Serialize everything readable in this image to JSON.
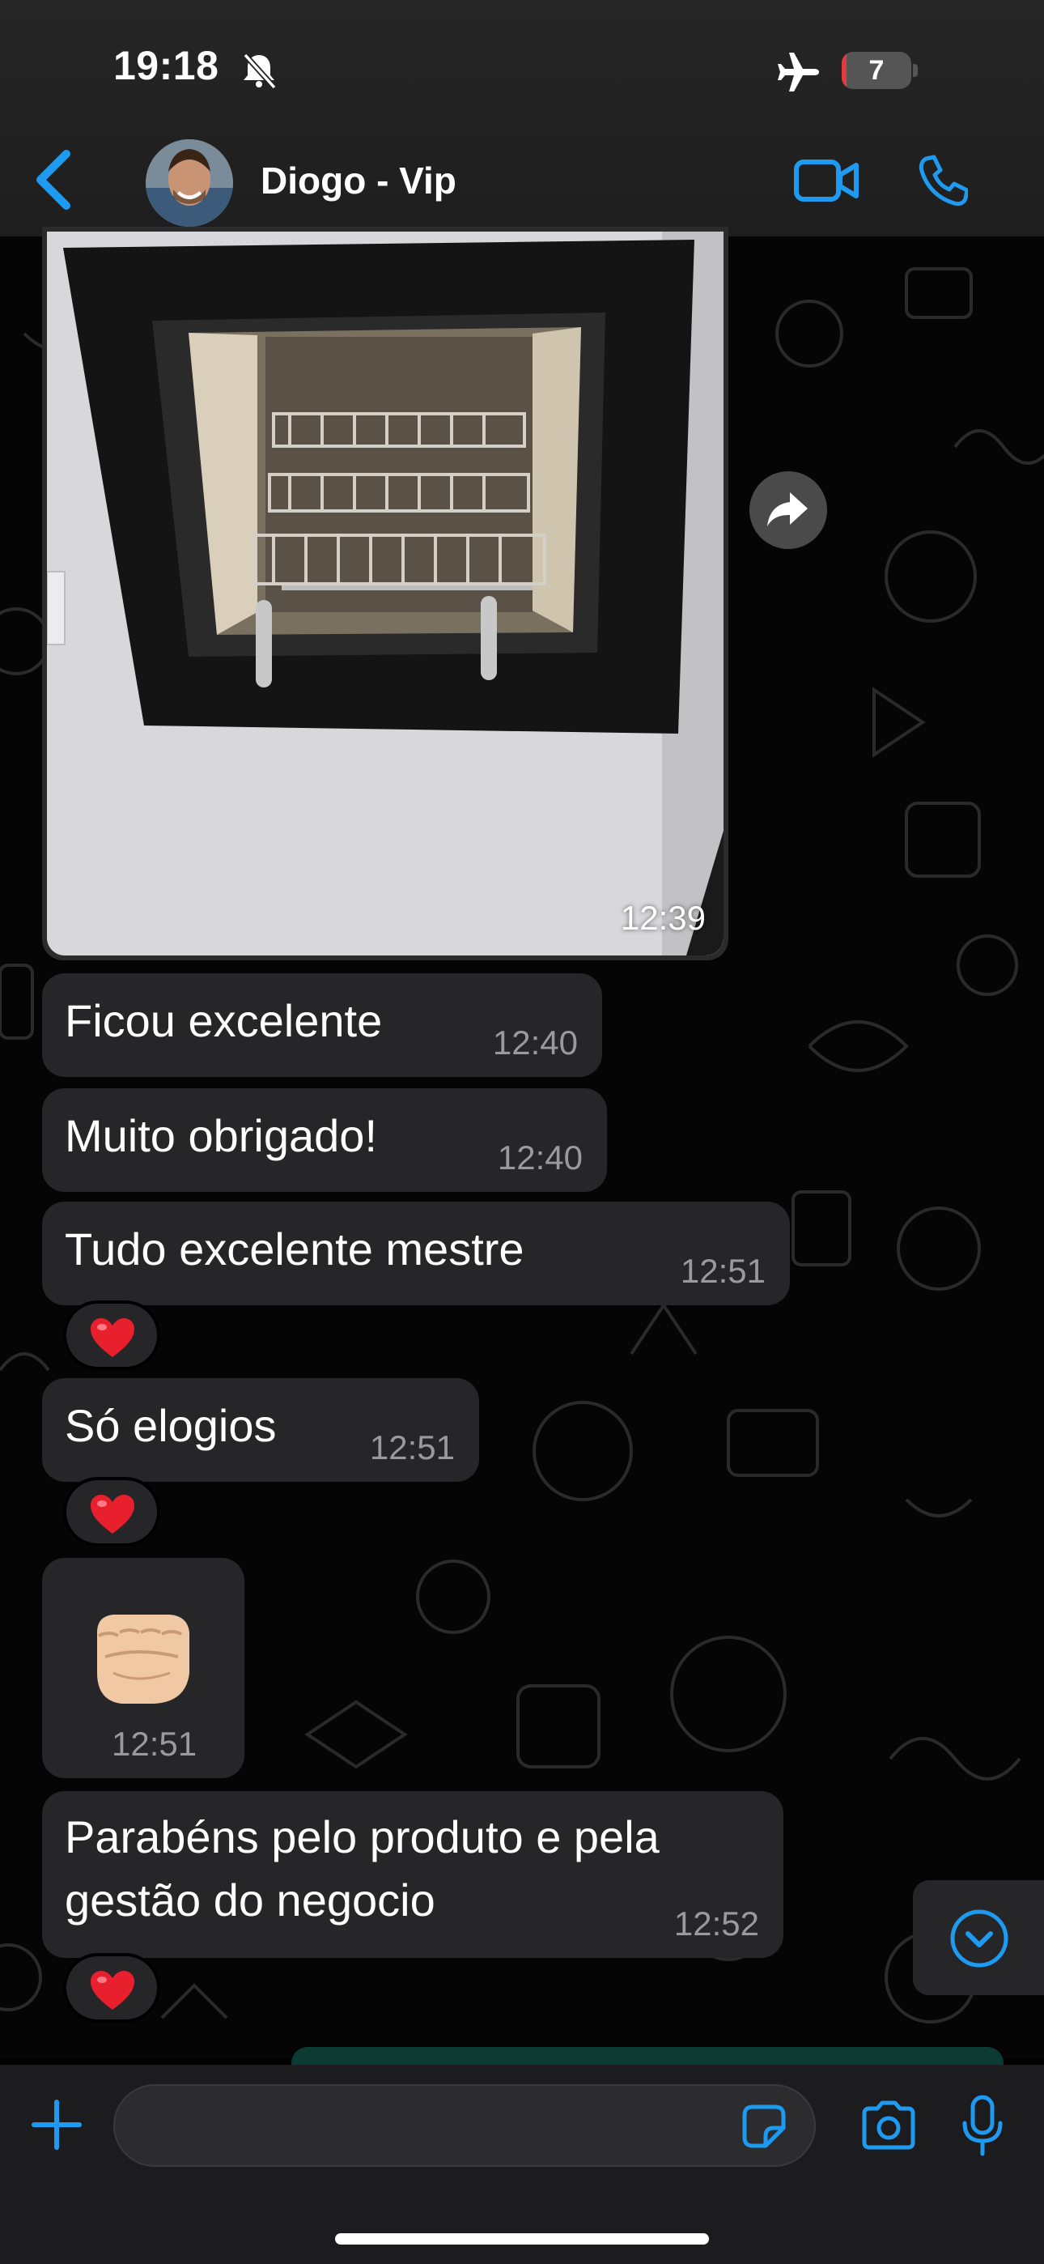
{
  "status_bar": {
    "time": "19:18",
    "battery_level": "7",
    "battery_fraction": 0.07,
    "mute_icon": "bell-slash-icon",
    "airplane_icon": "airplane-icon"
  },
  "header": {
    "contact_name": "Diogo - Vip",
    "back_icon": "chevron-left-icon",
    "video_icon": "video-camera-icon",
    "call_icon": "phone-icon"
  },
  "messages": [
    {
      "type": "image",
      "time": "12:39"
    },
    {
      "type": "text",
      "text": "Ficou excelente",
      "time": "12:40"
    },
    {
      "type": "text",
      "text": "Muito obrigado!",
      "time": "12:40"
    },
    {
      "type": "text",
      "text": "Tudo excelente mestre",
      "time": "12:51",
      "reaction": "❤️"
    },
    {
      "type": "text",
      "text": "Só elogios",
      "time": "12:51",
      "reaction": "❤️"
    },
    {
      "type": "emoji",
      "emoji": "👊🏼",
      "time": "12:51"
    },
    {
      "type": "text",
      "lines": [
        "Parabéns pelo produto e pela",
        "gestão do negocio"
      ],
      "time": "12:52",
      "reaction": "❤️"
    }
  ],
  "composer": {
    "plus_icon": "plus-icon",
    "sticker_icon": "sticker-icon",
    "camera_icon": "camera-icon",
    "mic_icon": "microphone-icon"
  },
  "colors": {
    "accent": "#1e9bf0",
    "bubble": "#262628",
    "background": "#000000",
    "timestamp": "#9a9a9d"
  }
}
